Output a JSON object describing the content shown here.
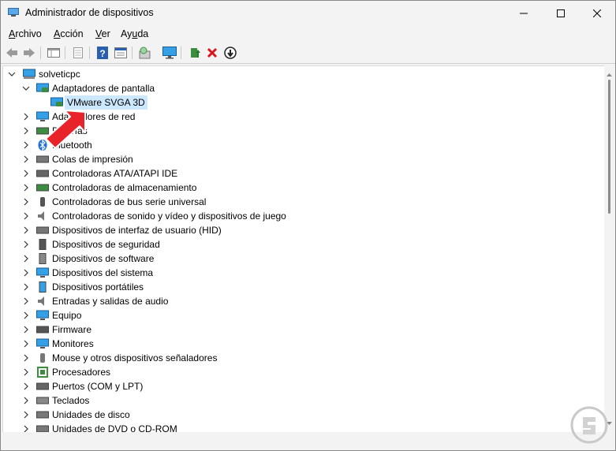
{
  "window": {
    "title": "Administrador de dispositivos"
  },
  "menu": [
    {
      "pre": "",
      "key": "A",
      "post": "rchivo"
    },
    {
      "pre": "",
      "key": "A",
      "post": "cción"
    },
    {
      "pre": "",
      "key": "V",
      "post": "er"
    },
    {
      "pre": "Ay",
      "key": "u",
      "post": "da"
    }
  ],
  "toolbar": {
    "buttons": [
      "back-icon",
      "forward-icon",
      "properties-panel-icon",
      "list-view-icon",
      "help-icon",
      "details-view-icon",
      "scan-hardware-icon",
      "monitor-icon",
      "update-driver-icon",
      "uninstall-icon",
      "disable-icon"
    ]
  },
  "tree": {
    "root": "solveticpc",
    "expanded_category": "Adaptadores de pantalla",
    "selected_device": "VMware SVGA 3D",
    "categories": [
      "Adaptadores de red",
      "Baterías",
      "Bluetooth",
      "Colas de impresión",
      "Controladoras ATA/ATAPI IDE",
      "Controladoras de almacenamiento",
      "Controladoras de bus serie universal",
      "Controladoras de sonido y vídeo y dispositivos de juego",
      "Dispositivos de interfaz de usuario (HID)",
      "Dispositivos de seguridad",
      "Dispositivos de software",
      "Dispositivos del sistema",
      "Dispositivos portátiles",
      "Entradas y salidas de audio",
      "Equipo",
      "Firmware",
      "Monitores",
      "Mouse y otros dispositivos señaladores",
      "Procesadores",
      "Puertos (COM y LPT)",
      "Teclados",
      "Unidades de disco",
      "Unidades de DVD o CD-ROM"
    ]
  },
  "colors": {
    "accent": "#0078d4",
    "selection": "#cce8ff",
    "arrow": "#e8232a"
  }
}
